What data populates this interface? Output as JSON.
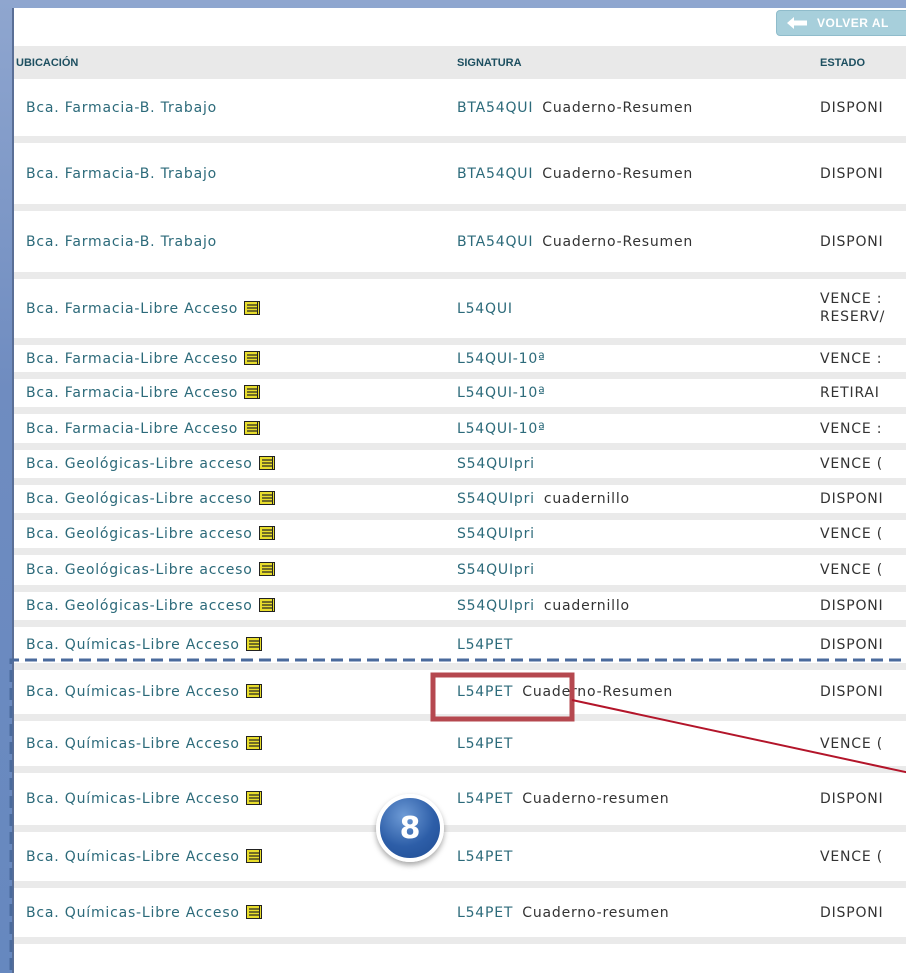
{
  "toolbar": {
    "back_label": "VOLVER AL"
  },
  "table": {
    "headers": {
      "ubicacion": "UBICACIÓN",
      "signatura": "SIGNATURA",
      "estado": "ESTADO"
    },
    "rows": [
      {
        "ubicacion": "Bca. Farmacia-B. Trabajo",
        "signatura": "BTA54QUI",
        "nota": "Cuaderno-Resumen",
        "estado": "DISPONI",
        "book_icon": false
      },
      {
        "ubicacion": "Bca. Farmacia-B. Trabajo",
        "signatura": "BTA54QUI",
        "nota": "Cuaderno-Resumen",
        "estado": "DISPONI",
        "book_icon": false
      },
      {
        "ubicacion": "Bca. Farmacia-B. Trabajo",
        "signatura": "BTA54QUI",
        "nota": "Cuaderno-Resumen",
        "estado": "DISPONI",
        "book_icon": false
      },
      {
        "ubicacion": "Bca. Farmacia-Libre Acceso",
        "signatura": "L54QUI",
        "nota": "",
        "estado": "VENCE :",
        "estado2": "RESERV/",
        "book_icon": true
      },
      {
        "ubicacion": "Bca. Farmacia-Libre Acceso",
        "signatura": "L54QUI-10ª",
        "nota": "",
        "estado": "VENCE :",
        "book_icon": true
      },
      {
        "ubicacion": "Bca. Farmacia-Libre Acceso",
        "signatura": "L54QUI-10ª",
        "nota": "",
        "estado": "RETIRAI",
        "book_icon": true
      },
      {
        "ubicacion": "Bca. Farmacia-Libre Acceso",
        "signatura": "L54QUI-10ª",
        "nota": "",
        "estado": "VENCE :",
        "book_icon": true
      },
      {
        "ubicacion": "Bca. Geológicas-Libre acceso",
        "signatura": "S54QUIpri",
        "nota": "",
        "estado": "VENCE (",
        "book_icon": true
      },
      {
        "ubicacion": "Bca. Geológicas-Libre acceso",
        "signatura": "S54QUIpri",
        "nota": "cuadernillo",
        "estado": "DISPONI",
        "book_icon": true
      },
      {
        "ubicacion": "Bca. Geológicas-Libre acceso",
        "signatura": "S54QUIpri",
        "nota": "",
        "estado": "VENCE (",
        "book_icon": true
      },
      {
        "ubicacion": "Bca. Geológicas-Libre acceso",
        "signatura": "S54QUIpri",
        "nota": "",
        "estado": "VENCE (",
        "book_icon": true
      },
      {
        "ubicacion": "Bca. Geológicas-Libre acceso",
        "signatura": "S54QUIpri",
        "nota": "cuadernillo",
        "estado": "DISPONI",
        "book_icon": true
      },
      {
        "ubicacion": "Bca. Químicas-Libre Acceso",
        "signatura": "L54PET",
        "nota": "",
        "estado": "DISPONI",
        "book_icon": true
      },
      {
        "ubicacion": "Bca. Químicas-Libre Acceso",
        "signatura": "L54PET",
        "nota": "Cuaderno-Resumen",
        "estado": "DISPONI",
        "book_icon": true
      },
      {
        "ubicacion": "Bca. Químicas-Libre Acceso",
        "signatura": "L54PET",
        "nota": "",
        "estado": "VENCE (",
        "book_icon": true
      },
      {
        "ubicacion": "Bca. Químicas-Libre Acceso",
        "signatura": "L54PET",
        "nota": "Cuaderno-resumen",
        "estado": "DISPONI",
        "book_icon": true
      },
      {
        "ubicacion": "Bca. Químicas-Libre Acceso",
        "signatura": "L54PET",
        "nota": "",
        "estado": "VENCE (",
        "book_icon": true
      },
      {
        "ubicacion": "Bca. Químicas-Libre Acceso",
        "signatura": "L54PET",
        "nota": "Cuaderno-resumen",
        "estado": "DISPONI",
        "book_icon": true
      }
    ]
  },
  "annotation": {
    "badge_label": "8"
  },
  "colors": {
    "link": "#2c6a7a",
    "highlight": "#b5484f",
    "callout_line": "#b3152a",
    "dashed_frame": "#4a6a9c",
    "badge": "#2d5ea8"
  }
}
